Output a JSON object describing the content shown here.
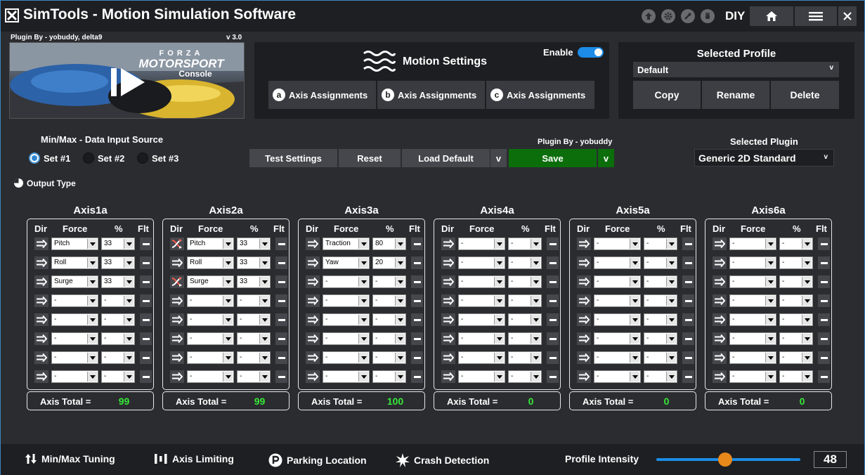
{
  "app": {
    "title": "SimTools - Motion Simulation Software",
    "diy_label": "DIY"
  },
  "plugin": {
    "by_label": "Plugin By - yobuddy, delta9",
    "version": "v 3.0",
    "game_logo_top": "FORZA",
    "game_logo_middle": "MOTORSPORT",
    "game_logo_bottom": "Console"
  },
  "motion_settings": {
    "title": "Motion Settings",
    "enable_label": "Enable",
    "enabled": true,
    "axis_assignments": [
      {
        "badge": "a",
        "label": "Axis Assignments"
      },
      {
        "badge": "b",
        "label": "Axis Assignments"
      },
      {
        "badge": "c",
        "label": "Axis Assignments"
      }
    ]
  },
  "profile": {
    "title": "Selected Profile",
    "selected": "Default",
    "buttons": {
      "copy": "Copy",
      "rename": "Rename",
      "delete": "Delete"
    }
  },
  "data_source": {
    "label": "Min/Max - Data Input Source",
    "options": [
      "Set #1",
      "Set #2",
      "Set #3"
    ],
    "selected_index": 0
  },
  "output_type_label": "Output Type",
  "actions": {
    "test_settings": "Test Settings",
    "reset": "Reset",
    "load_default": "Load Default",
    "dropdown_caret": "v",
    "save": "Save",
    "plugin_by_label": "Plugin By - yobuddy"
  },
  "selected_plugin": {
    "label": "Selected Plugin",
    "value": "Generic 2D Standard"
  },
  "axis_headers": {
    "dir": "Dir",
    "force": "Force",
    "pct": "%",
    "flt": "Flt"
  },
  "axis_total_label": "Axis Total =",
  "axes": [
    {
      "name": "Axis1a",
      "total": "99",
      "rows": [
        {
          "dir": "normal",
          "force": "Pitch",
          "pct": "33"
        },
        {
          "dir": "normal",
          "force": "Roll",
          "pct": "33"
        },
        {
          "dir": "normal",
          "force": "Surge",
          "pct": "33"
        },
        {
          "dir": "normal",
          "force": "-",
          "pct": "-"
        },
        {
          "dir": "normal",
          "force": "-",
          "pct": "-"
        },
        {
          "dir": "normal",
          "force": "-",
          "pct": "-"
        },
        {
          "dir": "normal",
          "force": "-",
          "pct": "-"
        },
        {
          "dir": "normal",
          "force": "-",
          "pct": "-"
        }
      ]
    },
    {
      "name": "Axis2a",
      "total": "99",
      "rows": [
        {
          "dir": "inverted",
          "force": "Pitch",
          "pct": "33"
        },
        {
          "dir": "normal",
          "force": "Roll",
          "pct": "33"
        },
        {
          "dir": "inverted",
          "force": "Surge",
          "pct": "33"
        },
        {
          "dir": "normal",
          "force": "-",
          "pct": "-"
        },
        {
          "dir": "normal",
          "force": "-",
          "pct": "-"
        },
        {
          "dir": "normal",
          "force": "-",
          "pct": "-"
        },
        {
          "dir": "normal",
          "force": "-",
          "pct": "-"
        },
        {
          "dir": "normal",
          "force": "-",
          "pct": "-"
        }
      ]
    },
    {
      "name": "Axis3a",
      "total": "100",
      "rows": [
        {
          "dir": "normal",
          "force": "Traction",
          "pct": "80"
        },
        {
          "dir": "normal",
          "force": "Yaw",
          "pct": "20"
        },
        {
          "dir": "normal",
          "force": "-",
          "pct": "-"
        },
        {
          "dir": "normal",
          "force": "-",
          "pct": "-"
        },
        {
          "dir": "normal",
          "force": "-",
          "pct": "-"
        },
        {
          "dir": "normal",
          "force": "-",
          "pct": "-"
        },
        {
          "dir": "normal",
          "force": "-",
          "pct": "-"
        },
        {
          "dir": "normal",
          "force": "-",
          "pct": "-"
        }
      ]
    },
    {
      "name": "Axis4a",
      "total": "0",
      "rows": [
        {
          "dir": "normal",
          "force": "-",
          "pct": "-"
        },
        {
          "dir": "normal",
          "force": "-",
          "pct": "-"
        },
        {
          "dir": "normal",
          "force": "-",
          "pct": "-"
        },
        {
          "dir": "normal",
          "force": "-",
          "pct": "-"
        },
        {
          "dir": "normal",
          "force": "-",
          "pct": "-"
        },
        {
          "dir": "normal",
          "force": "-",
          "pct": "-"
        },
        {
          "dir": "normal",
          "force": "-",
          "pct": "-"
        },
        {
          "dir": "normal",
          "force": "-",
          "pct": "-"
        }
      ]
    },
    {
      "name": "Axis5a",
      "total": "0",
      "rows": [
        {
          "dir": "normal",
          "force": "-",
          "pct": "-"
        },
        {
          "dir": "normal",
          "force": "-",
          "pct": "-"
        },
        {
          "dir": "normal",
          "force": "-",
          "pct": "-"
        },
        {
          "dir": "normal",
          "force": "-",
          "pct": "-"
        },
        {
          "dir": "normal",
          "force": "-",
          "pct": "-"
        },
        {
          "dir": "normal",
          "force": "-",
          "pct": "-"
        },
        {
          "dir": "normal",
          "force": "-",
          "pct": "-"
        },
        {
          "dir": "normal",
          "force": "-",
          "pct": "-"
        }
      ]
    },
    {
      "name": "Axis6a",
      "total": "0",
      "rows": [
        {
          "dir": "normal",
          "force": "-",
          "pct": "-"
        },
        {
          "dir": "normal",
          "force": "-",
          "pct": "-"
        },
        {
          "dir": "normal",
          "force": "-",
          "pct": "-"
        },
        {
          "dir": "normal",
          "force": "-",
          "pct": "-"
        },
        {
          "dir": "normal",
          "force": "-",
          "pct": "-"
        },
        {
          "dir": "normal",
          "force": "-",
          "pct": "-"
        },
        {
          "dir": "normal",
          "force": "-",
          "pct": "-"
        },
        {
          "dir": "normal",
          "force": "-",
          "pct": "-"
        }
      ]
    }
  ],
  "footer": {
    "minmax_tuning": "Min/Max Tuning",
    "axis_limiting": "Axis Limiting",
    "parking_location": "Parking Location",
    "crash_detection": "Crash Detection",
    "profile_intensity_label": "Profile Intensity",
    "profile_intensity_value": "48",
    "profile_intensity_fraction": 0.48
  },
  "colors": {
    "accent_blue": "#1c8ce6",
    "save_green": "#0b6e0b",
    "total_green": "#36e836",
    "slider_knob": "#e8891b"
  },
  "icons": {
    "titlebar": [
      "arrow-up-icon",
      "gear-icon",
      "wrench-icon",
      "hand-stop-icon",
      "home-icon",
      "menu-icon",
      "close-icon"
    ],
    "direction_normal": "double-arrow-right-icon",
    "direction_inverted": "crossed-arrows-icon",
    "float": "minus-icon"
  }
}
